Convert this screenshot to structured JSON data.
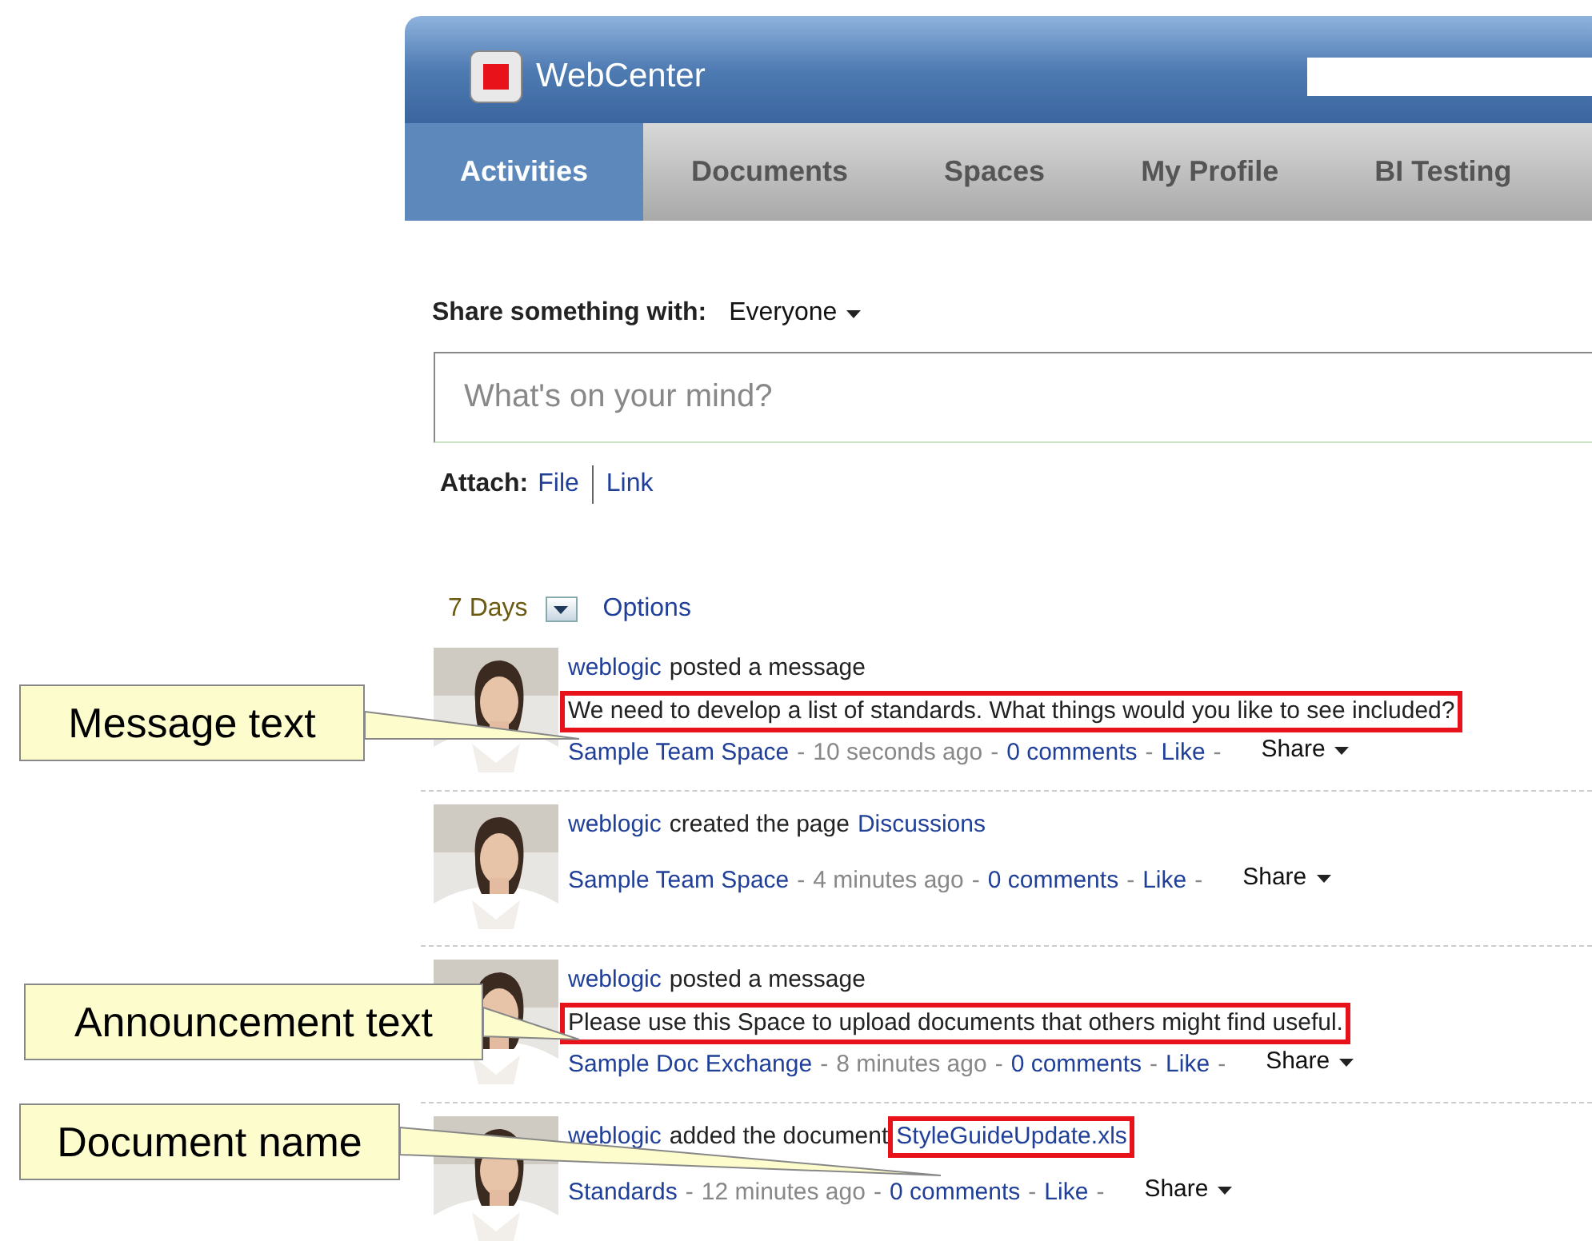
{
  "header": {
    "app_name": "WebCenter"
  },
  "tabs": [
    {
      "label": "Activities",
      "selected": true
    },
    {
      "label": "Documents",
      "selected": false
    },
    {
      "label": "Spaces",
      "selected": false
    },
    {
      "label": "My Profile",
      "selected": false
    },
    {
      "label": "BI Testing",
      "selected": false
    }
  ],
  "share": {
    "label": "Share something with:",
    "audience": "Everyone",
    "placeholder": "What's on your mind?",
    "attach_label": "Attach:",
    "attach_links": [
      "File",
      "Link"
    ]
  },
  "filter": {
    "period": "7 Days",
    "options": "Options"
  },
  "feed": {
    "separator": "-",
    "items": [
      {
        "actor": "weblogic",
        "action": "posted a message",
        "message": "We need to develop a list of standards. What things would you like to see included?",
        "highlighted": true,
        "space": "Sample Team Space",
        "time": "10 seconds ago",
        "comments": "0 comments",
        "like": "Like",
        "share": "Share"
      },
      {
        "actor": "weblogic",
        "action": "created the page",
        "object": "Discussions",
        "highlighted": false,
        "space": "Sample Team Space",
        "time": "4 minutes ago",
        "comments": "0 comments",
        "like": "Like",
        "share": "Share"
      },
      {
        "actor": "weblogic",
        "action": "posted a message",
        "message": "Please use this Space to upload documents that others might find useful.",
        "highlighted": true,
        "space": "Sample Doc Exchange",
        "time": "8 minutes ago",
        "comments": "0 comments",
        "like": "Like",
        "share": "Share"
      },
      {
        "actor": "weblogic",
        "action": "added the document",
        "object": "StyleGuideUpdate.xls",
        "highlighted": true,
        "space": "Standards",
        "time": "12 minutes ago",
        "comments": "0 comments",
        "like": "Like",
        "share": "Share"
      }
    ]
  },
  "callouts": [
    {
      "label": "Message text"
    },
    {
      "label": "Announcement text"
    },
    {
      "label": "Document name"
    }
  ]
}
